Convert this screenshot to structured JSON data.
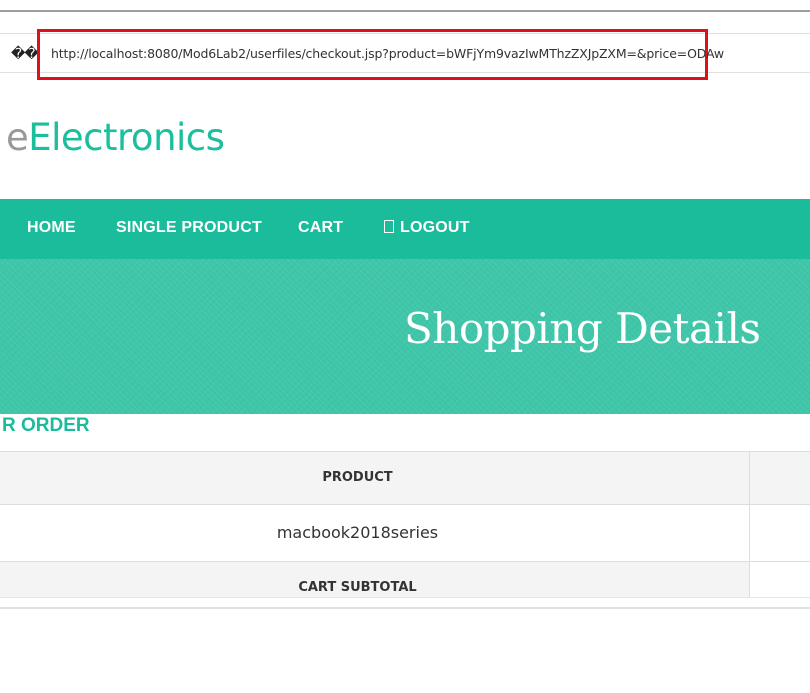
{
  "address_bar": {
    "glyphs": "��",
    "url": "http://localhost:8080/Mod6Lab2/userfiles/checkout.jsp?product=bWFjYm9vazIwMThzZXJpZXM=&price=ODAw"
  },
  "logo": {
    "prefix": "e",
    "name": "Electronics"
  },
  "nav": {
    "items": [
      {
        "label": "HOME"
      },
      {
        "label": "SINGLE PRODUCT"
      },
      {
        "label": "CART"
      },
      {
        "label": "LOGOUT",
        "icon": "user-icon"
      }
    ]
  },
  "banner": {
    "title": "Shopping Details"
  },
  "order": {
    "section_title": "R ORDER",
    "table": {
      "header": "PRODUCT",
      "product": "macbook2018series",
      "subtotal_label": "CART SUBTOTAL"
    }
  },
  "colors": {
    "accent": "#1abc9c",
    "highlight_box": "#e0101a",
    "logo_prefix": "#999999"
  }
}
